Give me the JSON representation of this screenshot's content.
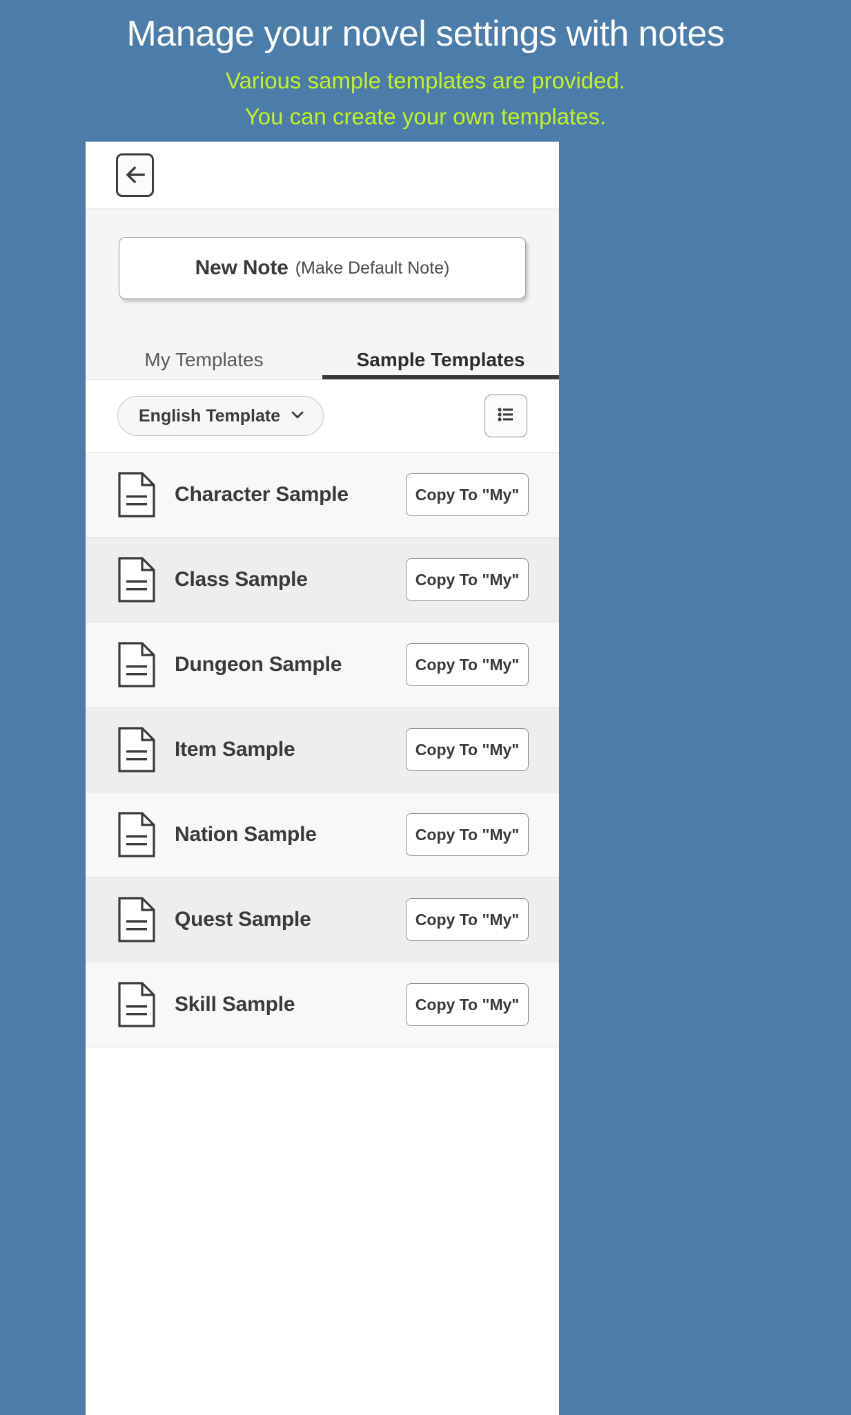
{
  "promo": {
    "title": "Manage your novel settings with notes",
    "subtitle_line1": "Various sample templates are provided.",
    "subtitle_line2": "You can create your own templates.",
    "background_color": "#4b7caa",
    "title_color": "#ffffff",
    "subtitle_color": "#c4f123"
  },
  "app": {
    "appbar": {
      "back_icon": "arrow-left-icon"
    },
    "new_note": {
      "main_label": "New Note",
      "sub_label": "(Make Default Note)"
    },
    "tabs": [
      {
        "label": "My Templates",
        "active": false
      },
      {
        "label": "Sample Templates",
        "active": true
      }
    ],
    "filter": {
      "language_value": "English Template",
      "chevron_icon": "chevron-down-icon",
      "list_view_icon": "list-bullets-icon"
    },
    "copy_button_label": "Copy To \"My\"",
    "templates": [
      {
        "name": "Character Sample",
        "icon": "document-icon"
      },
      {
        "name": "Class Sample",
        "icon": "document-icon"
      },
      {
        "name": "Dungeon Sample",
        "icon": "document-icon"
      },
      {
        "name": "Item Sample",
        "icon": "document-icon"
      },
      {
        "name": "Nation Sample",
        "icon": "document-icon"
      },
      {
        "name": "Quest Sample",
        "icon": "document-icon"
      },
      {
        "name": "Skill Sample",
        "icon": "document-icon"
      }
    ]
  }
}
